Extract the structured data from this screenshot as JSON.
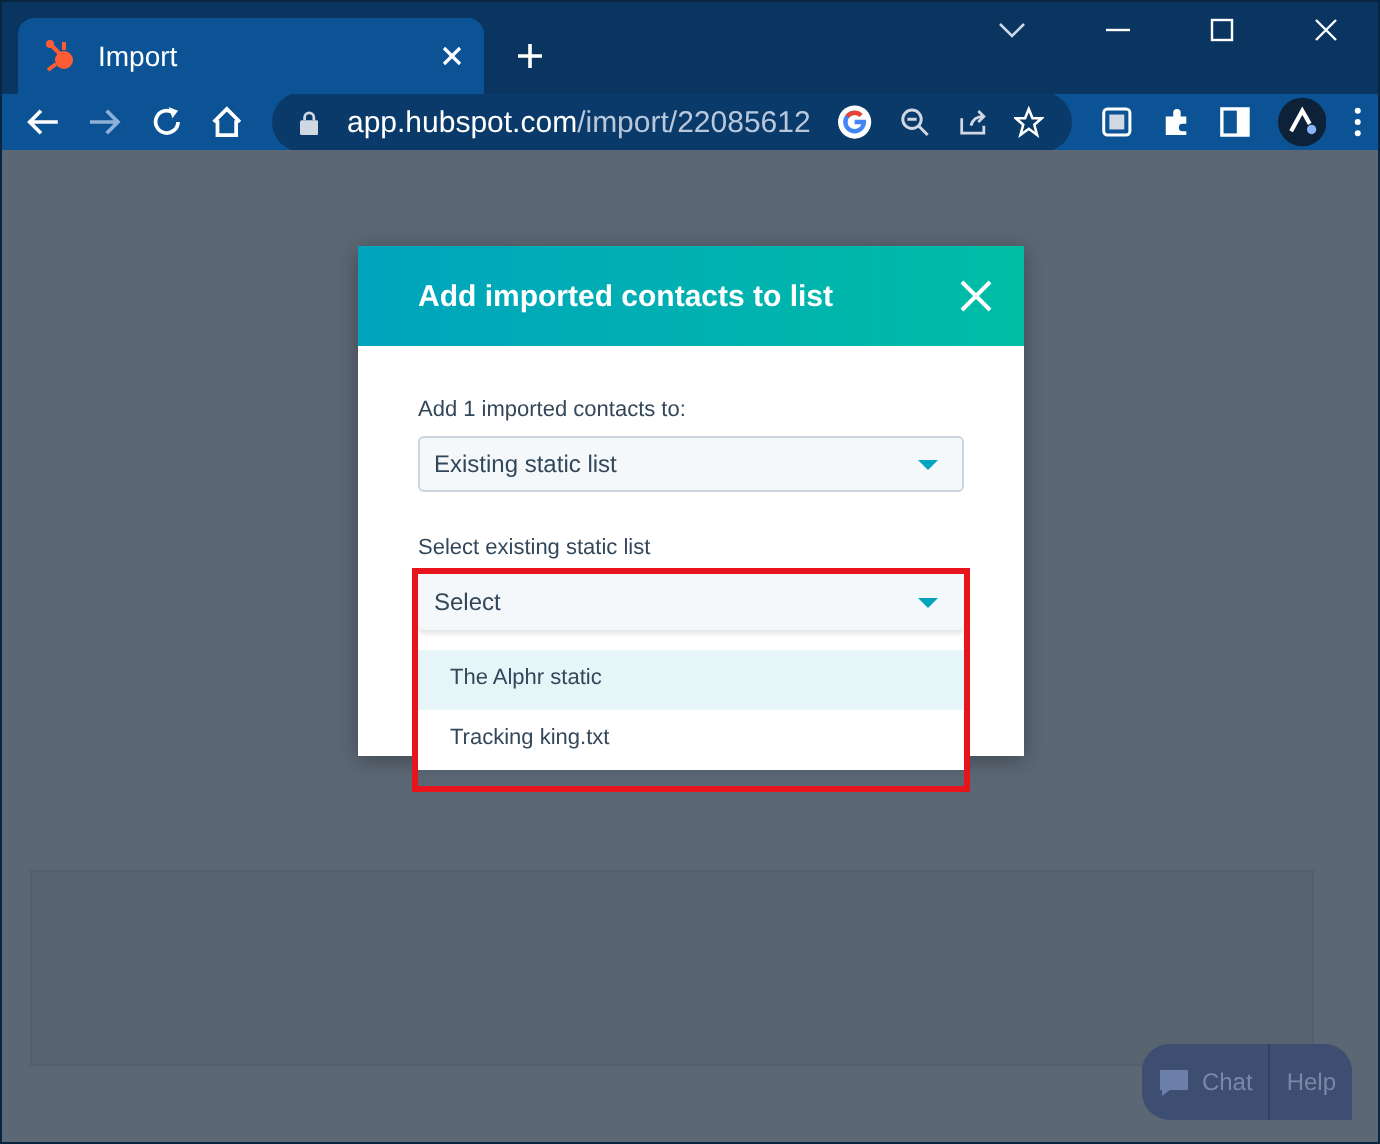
{
  "browser": {
    "tab": {
      "title": "Import"
    },
    "address": {
      "host": "app.hubspot.com",
      "path": "/import/22085612"
    }
  },
  "dialog": {
    "title": "Add imported contacts to list",
    "fields": [
      {
        "label": "Add 1 imported contacts to:",
        "value": "Existing static list"
      },
      {
        "label": "Select existing static list",
        "placeholder": "Select",
        "open": true
      }
    ],
    "options": [
      {
        "label": "The Alphr static",
        "highlighted": true
      },
      {
        "label": "Tracking king.txt",
        "highlighted": false
      }
    ]
  },
  "chat_widget": {
    "buttons": [
      "Chat",
      "Help"
    ]
  }
}
